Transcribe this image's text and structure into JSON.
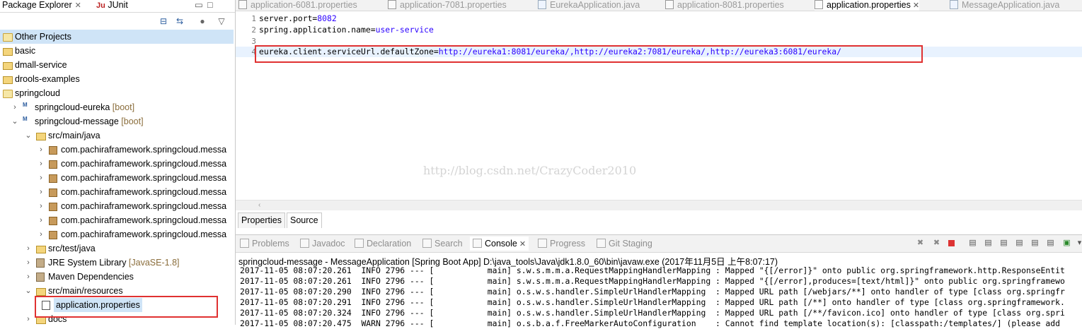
{
  "package_explorer": {
    "tabs": [
      {
        "label": "Package Explorer"
      },
      {
        "label": "JUnit",
        "icon": "junit-icon"
      }
    ],
    "tree": [
      {
        "label": "Other Projects",
        "decoration": "",
        "level": 0,
        "twisty": "",
        "icon": "working-set-icon",
        "selected": true
      },
      {
        "label": "basic",
        "decoration": "",
        "level": 0,
        "twisty": "",
        "icon": "folder-icon"
      },
      {
        "label": "dmall-service",
        "decoration": "",
        "level": 0,
        "twisty": "",
        "icon": "folder-icon"
      },
      {
        "label": "drools-examples",
        "decoration": "",
        "level": 0,
        "twisty": "",
        "icon": "folder-icon"
      },
      {
        "label": "springcloud",
        "decoration": "",
        "level": 0,
        "twisty": "",
        "icon": "working-set-icon"
      },
      {
        "label": "springcloud-eureka",
        "decoration": "[boot]",
        "level": 1,
        "twisty": "collapsed",
        "icon": "maven-project-icon"
      },
      {
        "label": "springcloud-message",
        "decoration": "[boot]",
        "level": 1,
        "twisty": "expanded",
        "icon": "maven-project-icon"
      },
      {
        "label": "src/main/java",
        "decoration": "",
        "level": 2,
        "twisty": "expanded",
        "icon": "source-folder-icon"
      },
      {
        "label": "com.pachiraframework.springcloud.messa",
        "decoration": "",
        "level": 3,
        "twisty": "collapsed",
        "icon": "package-icon"
      },
      {
        "label": "com.pachiraframework.springcloud.messa",
        "decoration": "",
        "level": 3,
        "twisty": "collapsed",
        "icon": "package-icon"
      },
      {
        "label": "com.pachiraframework.springcloud.messa",
        "decoration": "",
        "level": 3,
        "twisty": "collapsed",
        "icon": "package-icon"
      },
      {
        "label": "com.pachiraframework.springcloud.messa",
        "decoration": "",
        "level": 3,
        "twisty": "collapsed",
        "icon": "package-icon"
      },
      {
        "label": "com.pachiraframework.springcloud.messa",
        "decoration": "",
        "level": 3,
        "twisty": "collapsed",
        "icon": "package-icon"
      },
      {
        "label": "com.pachiraframework.springcloud.messa",
        "decoration": "",
        "level": 3,
        "twisty": "collapsed",
        "icon": "package-icon"
      },
      {
        "label": "com.pachiraframework.springcloud.messa",
        "decoration": "",
        "level": 3,
        "twisty": "collapsed",
        "icon": "package-icon"
      },
      {
        "label": "src/test/java",
        "decoration": "",
        "level": 2,
        "twisty": "collapsed",
        "icon": "source-folder-icon"
      },
      {
        "label": "JRE System Library",
        "decoration": "[JavaSE-1.8]",
        "level": 2,
        "twisty": "collapsed",
        "icon": "library-icon"
      },
      {
        "label": "Maven Dependencies",
        "decoration": "",
        "level": 2,
        "twisty": "collapsed",
        "icon": "library-icon"
      },
      {
        "label": "src/main/resources",
        "decoration": "",
        "level": 2,
        "twisty": "expanded",
        "icon": "source-folder-icon"
      },
      {
        "label": "application.properties",
        "decoration": "",
        "level": 3,
        "twisty": "",
        "icon": "properties-file-icon",
        "selected": true
      },
      {
        "label": "docs",
        "decoration": "",
        "level": 2,
        "twisty": "collapsed",
        "icon": "folder-icon"
      }
    ]
  },
  "editor": {
    "tabs": [
      {
        "label": "application-6081.properties",
        "active": false,
        "icon": "properties-file-icon"
      },
      {
        "label": "application-7081.properties",
        "active": false,
        "icon": "properties-file-icon"
      },
      {
        "label": "EurekaApplication.java",
        "active": false,
        "icon": "java-file-icon"
      },
      {
        "label": "application-8081.properties",
        "active": false,
        "icon": "properties-file-icon"
      },
      {
        "label": "application.properties",
        "active": true,
        "icon": "properties-file-icon"
      },
      {
        "label": "MessageApplication.java",
        "active": false,
        "icon": "java-file-icon"
      }
    ],
    "lines": [
      {
        "num": "1",
        "key": "server.port=",
        "value": "8082"
      },
      {
        "num": "2",
        "key": "spring.application.name=",
        "value": "user-service"
      },
      {
        "num": "3",
        "key": "",
        "value": ""
      },
      {
        "num": "4",
        "key": "eureka.client.serviceUrl.defaultZone=",
        "value": "http://eureka1:8081/eureka/,http://eureka2:7081/eureka/,http://eureka3:6081/eureka/"
      }
    ],
    "watermark": "http://blog.csdn.net/CrazyCoder2010",
    "bottom_tabs": [
      {
        "label": "Properties",
        "active": false
      },
      {
        "label": "Source",
        "active": true
      }
    ]
  },
  "console": {
    "tabs": [
      {
        "label": "Problems",
        "icon": "problems-icon",
        "active": false
      },
      {
        "label": "Javadoc",
        "icon": "javadoc-icon",
        "active": false
      },
      {
        "label": "Declaration",
        "icon": "declaration-icon",
        "active": false
      },
      {
        "label": "Search",
        "icon": "search-icon",
        "active": false
      },
      {
        "label": "Console",
        "icon": "console-icon",
        "active": true
      },
      {
        "label": "Progress",
        "icon": "progress-icon",
        "active": false
      },
      {
        "label": "Git Staging",
        "icon": "git-staging-icon",
        "active": false
      }
    ],
    "header": "springcloud-message - MessageApplication [Spring Boot App] D:\\java_tools\\Java\\jdk1.8.0_60\\bin\\javaw.exe (2017年11月5日 上午8:07:17)",
    "log_lines": [
      "2017-11-05 08:07:20.261  INFO 2796 --- [           main] s.w.s.m.m.a.RequestMappingHandlerMapping : Mapped \"{[/error]}\" onto public org.springframework.http.ResponseEntit",
      "2017-11-05 08:07:20.261  INFO 2796 --- [           main] s.w.s.m.m.a.RequestMappingHandlerMapping : Mapped \"{[/error],produces=[text/html]}\" onto public org.springframewo",
      "2017-11-05 08:07:20.290  INFO 2796 --- [           main] o.s.w.s.handler.SimpleUrlHandlerMapping  : Mapped URL path [/webjars/**] onto handler of type [class org.springfr",
      "2017-11-05 08:07:20.291  INFO 2796 --- [           main] o.s.w.s.handler.SimpleUrlHandlerMapping  : Mapped URL path [/**] onto handler of type [class org.springframework.",
      "2017-11-05 08:07:20.324  INFO 2796 --- [           main] o.s.w.s.handler.SimpleUrlHandlerMapping  : Mapped URL path [/**/favicon.ico] onto handler of type [class org.spri",
      "2017-11-05 08:07:20.475  WARN 2796 --- [           main] o.s.b.a.f.FreeMarkerAutoConfiguration    : Cannot find template location(s): [classpath:/templates/] (please add"
    ]
  },
  "colors": {
    "highlight_box": "#e03131",
    "property_value": "#2a00ff",
    "selection": "#cfe4f7"
  }
}
